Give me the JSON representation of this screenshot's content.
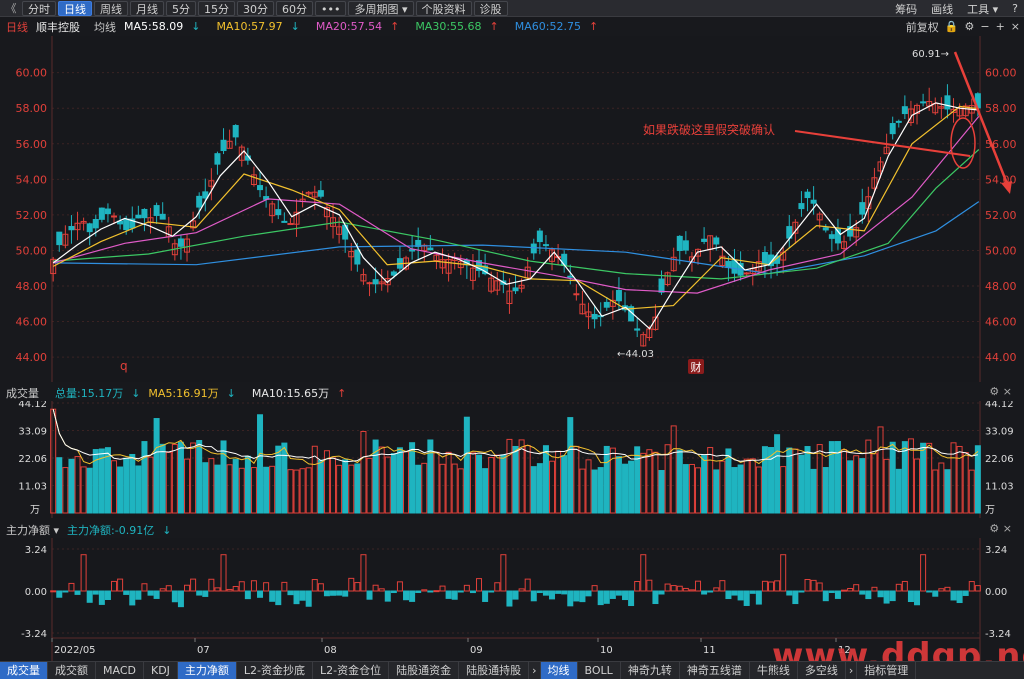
{
  "toolbar": {
    "back": "《",
    "buttons": [
      "分时",
      "日线",
      "周线",
      "月线",
      "5分",
      "15分",
      "30分",
      "60分",
      "•••",
      "多周期图 ▾",
      "个股资料",
      "诊股"
    ],
    "active_index": 1,
    "right": [
      "筹码",
      "画线",
      "工具 ▾",
      "?"
    ]
  },
  "info": {
    "period": "日线",
    "stock": "顺丰控股",
    "ma_label": "均线",
    "ma5": "MA5:58.09",
    "ma10": "MA10:57.97",
    "ma20": "MA20:57.54",
    "ma30": "MA30:55.68",
    "ma60": "MA60:52.75",
    "adjust": "前复权"
  },
  "colors": {
    "up": "#e0403a",
    "down": "#1fb4c0",
    "ma5": "#ffffff",
    "ma10": "#f2c12e",
    "ma20": "#e05bc8",
    "ma30": "#3cc864",
    "ma60": "#2f8fe0",
    "grid": "#3a2222",
    "axis_text": "#e0403a"
  },
  "price_panel": {
    "yticks": [
      "60.00",
      "58.00",
      "56.00",
      "54.00",
      "52.00",
      "50.00",
      "48.00",
      "46.00",
      "44.00"
    ],
    "high_label": "60.91→",
    "low_label": "←44.03",
    "annotation": "如果跌破这里假突破确认",
    "marker_q": "q",
    "marker_cai": "财"
  },
  "volume_panel": {
    "title": "成交量",
    "total": "总量:15.17万",
    "ma5": "MA5:16.91万",
    "ma10": "MA10:15.65万",
    "yticks": [
      "44.12",
      "33.09",
      "22.06",
      "11.03"
    ],
    "unit": "万"
  },
  "flow_panel": {
    "title": "主力净额 ▾",
    "value": "主力净额:-0.91亿",
    "yticks": [
      "3.24",
      "0.00",
      "-3.24"
    ]
  },
  "xaxis": [
    "2022/05",
    "07",
    "08",
    "09",
    "10",
    "11",
    "12"
  ],
  "bottom_tabs_left": [
    "成交量",
    "成交额",
    "MACD",
    "KDJ",
    "主力净额",
    "L2-资金抄底",
    "L2-资金仓位",
    "陆股通资金",
    "陆股通持股"
  ],
  "bottom_tabs_right": [
    "均线",
    "BOLL",
    "神奇九转",
    "神奇五线谱",
    "牛熊线",
    "多空线",
    "指标管理"
  ],
  "watermark": "www.ddgp.net",
  "chart_data": {
    "type": "candlestick",
    "price_range": [
      43.5,
      61.5
    ],
    "close_path": [
      [
        0,
        49.5
      ],
      [
        4,
        50.8
      ],
      [
        8,
        51.2
      ],
      [
        12,
        51.8
      ],
      [
        16,
        50.9
      ],
      [
        20,
        51.7
      ],
      [
        24,
        52.2
      ],
      [
        28,
        51.5
      ],
      [
        32,
        51.0
      ],
      [
        36,
        51.9
      ],
      [
        40,
        51.8
      ],
      [
        44,
        52.0
      ],
      [
        48,
        51.5
      ],
      [
        52,
        50.0
      ],
      [
        56,
        50.6
      ],
      [
        60,
        52.2
      ],
      [
        64,
        53.0
      ],
      [
        68,
        54.6
      ],
      [
        72,
        55.8
      ],
      [
        76,
        56.5
      ],
      [
        80,
        55.6
      ],
      [
        84,
        54.3
      ],
      [
        88,
        53.0
      ],
      [
        92,
        52.6
      ],
      [
        96,
        51.6
      ],
      [
        100,
        51.5
      ],
      [
        104,
        52.8
      ],
      [
        108,
        53.4
      ],
      [
        112,
        53.1
      ],
      [
        116,
        52.1
      ],
      [
        120,
        51.3
      ],
      [
        124,
        50.2
      ],
      [
        128,
        49.1
      ],
      [
        132,
        48.2
      ],
      [
        136,
        48.1
      ],
      [
        140,
        48.4
      ],
      [
        144,
        48.7
      ],
      [
        148,
        49.6
      ],
      [
        152,
        50.2
      ],
      [
        156,
        50.3
      ],
      [
        160,
        49.8
      ],
      [
        164,
        49.4
      ],
      [
        168,
        49.6
      ],
      [
        172,
        49.3
      ],
      [
        176,
        49.0
      ],
      [
        180,
        48.8
      ],
      [
        184,
        48.4
      ],
      [
        188,
        48.2
      ],
      [
        192,
        47.6
      ],
      [
        196,
        47.9
      ],
      [
        200,
        49.5
      ],
      [
        204,
        50.5
      ],
      [
        208,
        50.2
      ],
      [
        212,
        49.6
      ],
      [
        216,
        48.8
      ],
      [
        220,
        47.3
      ],
      [
        224,
        46.6
      ],
      [
        228,
        46.0
      ],
      [
        232,
        46.8
      ],
      [
        236,
        47.4
      ],
      [
        240,
        46.6
      ],
      [
        244,
        45.6
      ],
      [
        248,
        45.2
      ],
      [
        252,
        46.0
      ],
      [
        256,
        48.2
      ],
      [
        260,
        49.6
      ],
      [
        264,
        50.2
      ],
      [
        268,
        49.6
      ],
      [
        272,
        50.4
      ],
      [
        276,
        50.9
      ],
      [
        280,
        49.8
      ],
      [
        284,
        48.8
      ],
      [
        288,
        48.6
      ],
      [
        292,
        48.8
      ],
      [
        296,
        49.4
      ],
      [
        300,
        49.1
      ],
      [
        304,
        49.3
      ],
      [
        308,
        50.5
      ],
      [
        312,
        51.9
      ],
      [
        316,
        53.0
      ],
      [
        320,
        52.5
      ],
      [
        324,
        51.1
      ],
      [
        328,
        50.4
      ],
      [
        332,
        50.5
      ],
      [
        336,
        51.1
      ],
      [
        340,
        52.3
      ],
      [
        344,
        54.0
      ],
      [
        348,
        55.4
      ],
      [
        352,
        56.6
      ],
      [
        356,
        57.6
      ],
      [
        360,
        58.0
      ],
      [
        364,
        58.3
      ],
      [
        368,
        58.4
      ],
      [
        372,
        58.1
      ],
      [
        376,
        57.9
      ],
      [
        380,
        58.0
      ],
      [
        384,
        58.2
      ],
      [
        388,
        58.0
      ]
    ],
    "ma5_path": [
      [
        0,
        49.3
      ],
      [
        10,
        50.3
      ],
      [
        20,
        51.2
      ],
      [
        30,
        51.8
      ],
      [
        40,
        51.4
      ],
      [
        50,
        50.8
      ],
      [
        60,
        51.9
      ],
      [
        70,
        54.2
      ],
      [
        80,
        55.6
      ],
      [
        90,
        53.9
      ],
      [
        100,
        51.9
      ],
      [
        110,
        52.6
      ],
      [
        120,
        52.0
      ],
      [
        130,
        49.6
      ],
      [
        140,
        48.2
      ],
      [
        150,
        49.3
      ],
      [
        160,
        49.9
      ],
      [
        170,
        49.5
      ],
      [
        180,
        48.9
      ],
      [
        190,
        48.1
      ],
      [
        200,
        48.4
      ],
      [
        210,
        49.9
      ],
      [
        220,
        48.2
      ],
      [
        230,
        46.3
      ],
      [
        240,
        46.8
      ],
      [
        250,
        45.6
      ],
      [
        260,
        47.8
      ],
      [
        270,
        49.9
      ],
      [
        280,
        50.2
      ],
      [
        290,
        48.9
      ],
      [
        300,
        49.2
      ],
      [
        310,
        50.9
      ],
      [
        320,
        52.6
      ],
      [
        330,
        50.9
      ],
      [
        340,
        51.8
      ],
      [
        350,
        55.3
      ],
      [
        360,
        57.6
      ],
      [
        370,
        58.3
      ],
      [
        380,
        58.0
      ],
      [
        388,
        57.9
      ]
    ],
    "ma10_path": [
      [
        0,
        49.1
      ],
      [
        20,
        50.5
      ],
      [
        40,
        51.6
      ],
      [
        60,
        51.3
      ],
      [
        80,
        54.3
      ],
      [
        100,
        53.4
      ],
      [
        120,
        52.3
      ],
      [
        140,
        49.2
      ],
      [
        160,
        49.4
      ],
      [
        180,
        49.1
      ],
      [
        200,
        48.4
      ],
      [
        220,
        48.3
      ],
      [
        240,
        46.7
      ],
      [
        260,
        46.9
      ],
      [
        280,
        49.6
      ],
      [
        300,
        49.2
      ],
      [
        320,
        51.4
      ],
      [
        340,
        51.1
      ],
      [
        360,
        56.0
      ],
      [
        380,
        58.1
      ],
      [
        388,
        57.97
      ]
    ],
    "ma20_path": [
      [
        0,
        49.3
      ],
      [
        30,
        50.4
      ],
      [
        60,
        51.0
      ],
      [
        90,
        52.9
      ],
      [
        120,
        52.6
      ],
      [
        150,
        50.1
      ],
      [
        180,
        49.3
      ],
      [
        210,
        48.6
      ],
      [
        240,
        47.8
      ],
      [
        270,
        47.6
      ],
      [
        300,
        48.9
      ],
      [
        330,
        49.8
      ],
      [
        360,
        53.0
      ],
      [
        388,
        57.54
      ]
    ],
    "ma30_path": [
      [
        0,
        49.4
      ],
      [
        40,
        49.8
      ],
      [
        80,
        50.8
      ],
      [
        120,
        51.6
      ],
      [
        160,
        50.6
      ],
      [
        200,
        49.4
      ],
      [
        240,
        48.7
      ],
      [
        280,
        48.4
      ],
      [
        320,
        49.0
      ],
      [
        350,
        50.4
      ],
      [
        370,
        53.5
      ],
      [
        388,
        55.68
      ]
    ],
    "ma60_path": [
      [
        0,
        49.3
      ],
      [
        60,
        49.2
      ],
      [
        120,
        50.2
      ],
      [
        180,
        50.3
      ],
      [
        240,
        49.9
      ],
      [
        300,
        48.7
      ],
      [
        340,
        49.7
      ],
      [
        370,
        51.1
      ],
      [
        388,
        52.75
      ]
    ]
  }
}
